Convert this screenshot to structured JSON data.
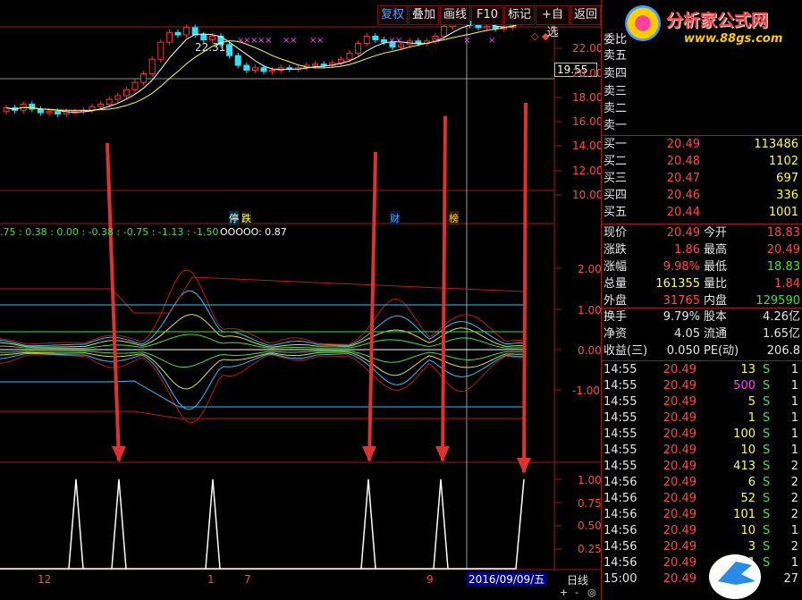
{
  "toolbar": {
    "buttons": [
      "复权",
      "叠加",
      "画线",
      "F10",
      "标记",
      "+自选",
      "返回"
    ]
  },
  "price_axis": [
    "22.00",
    "20.00",
    "18.00",
    "16.00",
    "14.00",
    "12.00",
    "10.00"
  ],
  "price_tag": "19.55",
  "high_label": "22.31",
  "event_tags": [
    {
      "text": "停",
      "color": "#40e0ff"
    },
    {
      "text": "跌",
      "color": "#ffff40"
    },
    {
      "text": "财",
      "color": "#40a0ff"
    },
    {
      "text": "榜",
      "color": "#ffcc00"
    }
  ],
  "indicator_readout": ".75 : 0.38 : 0.00 : -0.38 : -0.75 : -1.13 : -1.50",
  "indicator_readout_tail": "OOOOO: 0.87",
  "osc_axis": [
    "2.00",
    "1.00",
    "0.00",
    "-1.00"
  ],
  "signal_axis": [
    "1.00",
    "0.75",
    "0.50",
    "0.25"
  ],
  "date_marks": [
    "12",
    "1",
    "7",
    "9"
  ],
  "cursor_date": "2016/09/09/五",
  "period": "日线",
  "nav_buttons": [
    "+",
    "-",
    "◎"
  ],
  "logo": {
    "brand": "分析家公式网",
    "url": "www.88gs.com"
  },
  "quote": {
    "header": "委比",
    "asks": [
      {
        "label": "卖五",
        "price": "",
        "vol": ""
      },
      {
        "label": "卖四",
        "price": "",
        "vol": ""
      },
      {
        "label": "卖三",
        "price": "",
        "vol": ""
      },
      {
        "label": "卖二",
        "price": "",
        "vol": ""
      },
      {
        "label": "卖一",
        "price": "",
        "vol": ""
      }
    ],
    "bids": [
      {
        "label": "买一",
        "price": "20.49",
        "vol": "113486"
      },
      {
        "label": "买二",
        "price": "20.48",
        "vol": "1102"
      },
      {
        "label": "买三",
        "price": "20.47",
        "vol": "697"
      },
      {
        "label": "买四",
        "price": "20.46",
        "vol": "336"
      },
      {
        "label": "买五",
        "price": "20.44",
        "vol": "1001"
      }
    ],
    "stats": [
      {
        "l1": "现价",
        "v1": "20.49",
        "l2": "今开",
        "v2": "18.83"
      },
      {
        "l1": "涨跌",
        "v1": "1.86",
        "l2": "最高",
        "v2": "20.49"
      },
      {
        "l1": "涨幅",
        "v1": "9.98%",
        "l2": "最低",
        "v2": "18.83"
      },
      {
        "l1": "总量",
        "v1": "161355",
        "l2": "量比",
        "v2": "1.84"
      },
      {
        "l1": "外盘",
        "v1": "31765",
        "l2": "内盘",
        "v2": "129590"
      }
    ],
    "fundamentals": [
      {
        "l1": "换手",
        "v1": "9.79%",
        "l2": "股本",
        "v2": "4.26亿"
      },
      {
        "l1": "净资",
        "v1": "4.05",
        "l2": "流通",
        "v2": "1.65亿"
      },
      {
        "l1": "收益(三)",
        "v1": "0.050",
        "l2": "PE(动)",
        "v2": "206.8"
      }
    ],
    "ticks": [
      {
        "time": "14:55",
        "price": "20.49",
        "vol": "13",
        "side": "S",
        "n": "1"
      },
      {
        "time": "14:55",
        "price": "20.49",
        "vol": "500",
        "side": "S",
        "n": "1"
      },
      {
        "time": "14:55",
        "price": "20.49",
        "vol": "5",
        "side": "S",
        "n": "1"
      },
      {
        "time": "14:55",
        "price": "20.49",
        "vol": "1",
        "side": "S",
        "n": "1"
      },
      {
        "time": "14:55",
        "price": "20.49",
        "vol": "100",
        "side": "S",
        "n": "1"
      },
      {
        "time": "14:55",
        "price": "20.49",
        "vol": "10",
        "side": "S",
        "n": "1"
      },
      {
        "time": "14:55",
        "price": "20.49",
        "vol": "413",
        "side": "S",
        "n": "2"
      },
      {
        "time": "14:56",
        "price": "20.49",
        "vol": "6",
        "side": "S",
        "n": "2"
      },
      {
        "time": "14:56",
        "price": "20.49",
        "vol": "52",
        "side": "S",
        "n": "2"
      },
      {
        "time": "14:56",
        "price": "20.49",
        "vol": "101",
        "side": "S",
        "n": "2"
      },
      {
        "time": "14:56",
        "price": "20.49",
        "vol": "10",
        "side": "S",
        "n": "1"
      },
      {
        "time": "14:56",
        "price": "20.49",
        "vol": "3",
        "side": "S",
        "n": "2"
      },
      {
        "time": "14:56",
        "price": "20.49",
        "vol": "1",
        "side": "S",
        "n": "1"
      },
      {
        "time": "15:00",
        "price": "20.49",
        "vol": "",
        "side": "",
        "n": "27"
      }
    ]
  }
}
